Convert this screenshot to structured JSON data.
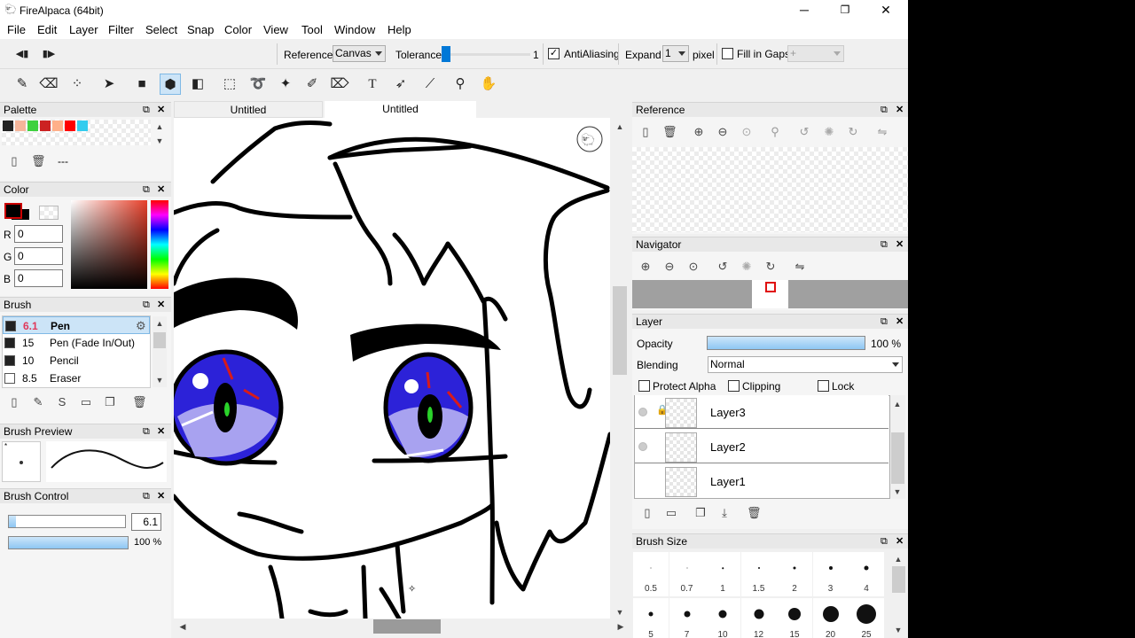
{
  "window": {
    "title": "FireAlpaca (64bit)",
    "minimize": "─",
    "maximize": "❐",
    "close": "✕"
  },
  "menu": [
    "File",
    "Edit",
    "Layer",
    "Filter",
    "Select",
    "Snap",
    "Color",
    "View",
    "Tool",
    "Window",
    "Help"
  ],
  "tool_options": {
    "reference_label": "Reference",
    "reference_value": "Canvas",
    "tolerance_label": "Tolerance",
    "tolerance_value": "1",
    "antialiasing_label": "AntiAliasing",
    "antialiasing_checked": true,
    "expand_label": "Expand",
    "expand_value": "1",
    "expand_unit": "pixel",
    "fill_gaps_label": "Fill in Gaps",
    "fill_gaps_value": "+"
  },
  "tabs": [
    "Untitled",
    "Untitled"
  ],
  "palette": {
    "title": "Palette",
    "colors": [
      "#222222",
      "#f5b59a",
      "#3ed13e",
      "#cc2222",
      "#ffb08a",
      "#ff0000",
      "#33ccee"
    ],
    "dash": "---"
  },
  "color": {
    "title": "Color",
    "r_label": "R",
    "g_label": "G",
    "b_label": "B",
    "r": "0",
    "g": "0",
    "b": "0"
  },
  "brush": {
    "title": "Brush",
    "items": [
      {
        "size": "6.1",
        "name": "Pen",
        "selected": true,
        "swatch": "#222222"
      },
      {
        "size": "15",
        "name": "Pen (Fade In/Out)",
        "swatch": "#222222"
      },
      {
        "size": "10",
        "name": "Pencil",
        "swatch": "#222222"
      },
      {
        "size": "8.5",
        "name": "Eraser",
        "swatch": "#ffffff"
      }
    ]
  },
  "brush_preview": {
    "title": "Brush Preview"
  },
  "brush_control": {
    "title": "Brush Control",
    "size_value": "6.1",
    "opacity_value": "100 %",
    "size_fraction": 0.06,
    "opacity_fraction": 1.0
  },
  "reference": {
    "title": "Reference"
  },
  "navigator": {
    "title": "Navigator"
  },
  "layer": {
    "title": "Layer",
    "opacity_label": "Opacity",
    "opacity_value": "100 %",
    "blending_label": "Blending",
    "blending_value": "Normal",
    "protect_alpha": "Protect Alpha",
    "clipping": "Clipping",
    "lock": "Lock",
    "layers": [
      "Layer3",
      "Layer2",
      "Layer1"
    ]
  },
  "brush_size": {
    "title": "Brush Size",
    "sizes": [
      "0.5",
      "0.7",
      "1",
      "1.5",
      "2",
      "3",
      "4",
      "5",
      "7",
      "10",
      "12",
      "15",
      "20",
      "25"
    ]
  },
  "colors": {
    "accent": "#0078d7",
    "selection": "#cce4f7",
    "panel": "#f0f0f0"
  }
}
